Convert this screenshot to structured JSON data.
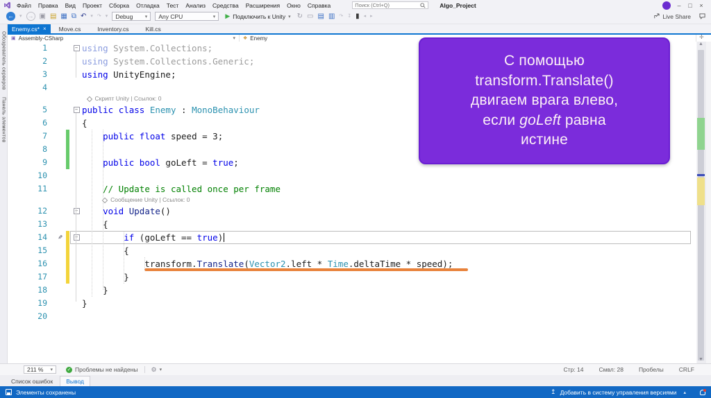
{
  "colors": {
    "accent_blue": "#0e75d1",
    "status_bar_blue": "#1168c4",
    "callout_purple": "#7b2cdb",
    "callout_border": "#6a1ed2",
    "marker_orange": "#e8823b",
    "change_bar_green": "#67cb6b",
    "change_bar_yellow": "#f3d43a",
    "keyword_blue": "#0000e8",
    "type_teal": "#2b91af",
    "comment_green": "#008000",
    "line_number_teal": "#2b91af"
  },
  "titlebar": {
    "title": "Algo_Project",
    "search_placeholder": "Поиск (Ctrl+Q)",
    "menu_items": [
      "Файл",
      "Правка",
      "Вид",
      "Проект",
      "Сборка",
      "Отладка",
      "Тест",
      "Анализ",
      "Средства",
      "Расширения",
      "Окно",
      "Справка"
    ],
    "window_buttons": [
      {
        "n": "minimize-button",
        "g": "–"
      },
      {
        "n": "maximize-button",
        "g": "□"
      },
      {
        "n": "close-button",
        "g": "×"
      }
    ]
  },
  "toolbar": {
    "debug_value": "Debug",
    "platform_value": "Any CPU",
    "attach_label": "Подключить к Unity",
    "live_share_label": "Live Share",
    "left_icons": [
      {
        "n": "navigate-backward-icon",
        "g": "←",
        "c": "circ-blue"
      },
      {
        "n": "navigate-backward-caret",
        "g": "▾",
        "c": "dim"
      },
      {
        "n": "navigate-forward-icon",
        "g": "→",
        "c": "circ-dim"
      },
      {
        "n": "new-project-icon",
        "g": "▣",
        "c": "mut"
      },
      {
        "n": "open-file-icon",
        "g": "▤",
        "c": "amber"
      },
      {
        "n": "save-icon",
        "g": "▦",
        "c": "blue"
      },
      {
        "n": "save-all-icon",
        "g": "⧉",
        "c": "blue"
      },
      {
        "n": "undo-icon",
        "g": "↶",
        "c": "navy"
      },
      {
        "n": "undo-caret",
        "g": "▾",
        "c": "dim"
      },
      {
        "n": "redo-icon",
        "g": "↷",
        "c": "dim"
      },
      {
        "n": "redo-caret",
        "g": "▾",
        "c": "dim"
      }
    ],
    "right_icons": [
      {
        "n": "hot-reload-icon",
        "g": "↻",
        "c": "mut"
      },
      {
        "n": "preview-window-icon",
        "g": "▭",
        "c": "mut"
      },
      {
        "n": "navigate-list-icon",
        "g": "▤",
        "c": "blue"
      },
      {
        "n": "diagnostics-icon",
        "g": "▥",
        "c": "blue"
      },
      {
        "n": "step-over-icon",
        "g": "↷",
        "c": "dim"
      },
      {
        "n": "step-into-icon",
        "g": "↧",
        "c": "dim"
      },
      {
        "n": "bookmark-icon",
        "g": "▮",
        "c": "dark"
      },
      {
        "n": "prev-bookmark-icon",
        "g": "◂",
        "c": "dim"
      },
      {
        "n": "next-bookmark-icon",
        "g": "▸",
        "c": "dim"
      }
    ]
  },
  "side_strip": {
    "labels": [
      "Обозреватель серверов",
      "Панель элементов"
    ]
  },
  "tabs": [
    {
      "label": "Enemy.cs*",
      "active": true
    },
    {
      "label": "Move.cs",
      "active": false
    },
    {
      "label": "Inventory.cs",
      "active": false
    },
    {
      "label": "Kill.cs",
      "active": false
    }
  ],
  "breadcrumb": {
    "project": "Assembly-CSharp",
    "type_name": "Enemy"
  },
  "editor": {
    "rows": [
      {
        "n": "1",
        "fold": true,
        "tk": [
          [
            "kd",
            "using"
          ],
          [
            "d",
            " System.Collections;"
          ]
        ]
      },
      {
        "n": "2",
        "tk": [
          [
            "kd",
            "using"
          ],
          [
            "d",
            " System.Collections.Generic;"
          ]
        ]
      },
      {
        "n": "3",
        "tk": [
          [
            "k",
            "using"
          ],
          [
            "p",
            " UnityEngine;"
          ]
        ]
      },
      {
        "n": "4",
        "tk": []
      },
      {
        "lens": true,
        "ind": 1,
        "text": "Скрипт Unity | Ссылок: 0"
      },
      {
        "n": "5",
        "fold": true,
        "tk": [
          [
            "k",
            "public"
          ],
          [
            "p",
            " "
          ],
          [
            "k",
            "class"
          ],
          [
            "p",
            " "
          ],
          [
            "t",
            "Enemy"
          ],
          [
            "p",
            " : "
          ],
          [
            "t",
            "MonoBehaviour"
          ]
        ]
      },
      {
        "n": "6",
        "tk": [
          [
            "p",
            "{"
          ]
        ]
      },
      {
        "n": "7",
        "bar": "g",
        "tk": [
          [
            "p",
            "    "
          ],
          [
            "k",
            "public"
          ],
          [
            "p",
            " "
          ],
          [
            "k",
            "float"
          ],
          [
            "p",
            " speed = 3;"
          ]
        ]
      },
      {
        "n": "8",
        "bar": "g",
        "tk": []
      },
      {
        "n": "9",
        "bar": "g",
        "tk": [
          [
            "p",
            "    "
          ],
          [
            "k",
            "public"
          ],
          [
            "p",
            " "
          ],
          [
            "k",
            "bool"
          ],
          [
            "p",
            " goLeft = "
          ],
          [
            "k",
            "true"
          ],
          [
            "p",
            ";"
          ]
        ]
      },
      {
        "n": "10",
        "tk": []
      },
      {
        "n": "11",
        "tk": [
          [
            "p",
            "    "
          ],
          [
            "c",
            "// Update is called once per frame"
          ]
        ]
      },
      {
        "lens": true,
        "ind": 4,
        "text": "Сообщение Unity | Ссылок: 0"
      },
      {
        "n": "12",
        "fold": true,
        "tk": [
          [
            "p",
            "    "
          ],
          [
            "k",
            "void"
          ],
          [
            "p",
            " "
          ],
          [
            "m",
            "Update"
          ],
          [
            "p",
            "()"
          ]
        ]
      },
      {
        "n": "13",
        "tk": [
          [
            "p",
            "    {"
          ]
        ]
      },
      {
        "n": "14",
        "fold": true,
        "pencil": true,
        "bar": "y",
        "outline": true,
        "caret": true,
        "tk": [
          [
            "p",
            "        "
          ],
          [
            "k",
            "if"
          ],
          [
            "p",
            " (goLeft == "
          ],
          [
            "k",
            "true"
          ],
          [
            "p",
            ")"
          ]
        ]
      },
      {
        "n": "15",
        "bar": "y",
        "tk": [
          [
            "p",
            "        {"
          ]
        ]
      },
      {
        "n": "16",
        "bar": "y",
        "underline": true,
        "tk": [
          [
            "p",
            "            transform."
          ],
          [
            "m",
            "Translate"
          ],
          [
            "p",
            "("
          ],
          [
            "t",
            "Vector2"
          ],
          [
            "p",
            ".left * "
          ],
          [
            "t",
            "Time"
          ],
          [
            "p",
            ".deltaTime * speed);"
          ]
        ]
      },
      {
        "n": "17",
        "bar": "y",
        "tk": [
          [
            "p",
            "        }"
          ]
        ]
      },
      {
        "n": "18",
        "tk": [
          [
            "p",
            "    }"
          ]
        ]
      },
      {
        "n": "19",
        "tk": [
          [
            "p",
            "}"
          ]
        ]
      },
      {
        "n": "20",
        "tk": []
      }
    ]
  },
  "callout": {
    "lines": [
      [
        {
          "t": "С помощью"
        }
      ],
      [
        {
          "t": "transform.Translate()"
        }
      ],
      [
        {
          "t": "двигаем врага влево,"
        }
      ],
      [
        {
          "t": "если "
        },
        {
          "t": "goLeft",
          "i": true
        },
        {
          "t": " равна"
        }
      ],
      [
        {
          "t": "истине"
        }
      ]
    ]
  },
  "footer": {
    "zoom_level": "211 %",
    "health_text": "Проблемы не найдены",
    "right_segments": [
      "Стр: 14",
      "Смвл: 28",
      "Пробелы",
      "CRLF"
    ]
  },
  "panel": {
    "tabs": [
      {
        "label": "Список ошибок",
        "active": false
      },
      {
        "label": "Вывод",
        "active": true
      }
    ]
  },
  "statusbar": {
    "left_text": "Элементы сохранены",
    "right_text": "Добавить в систему управления версиями"
  }
}
